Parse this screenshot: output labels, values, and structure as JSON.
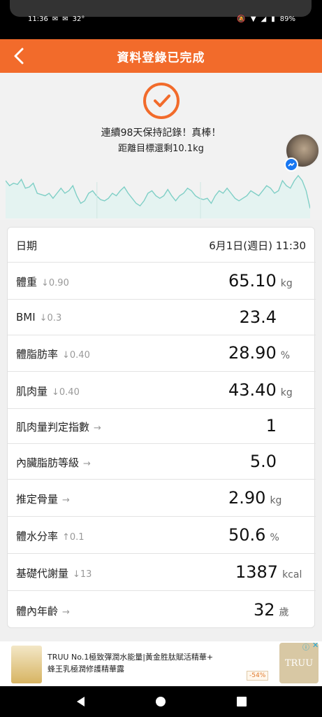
{
  "status_bar": {
    "time": "11:36",
    "temp": "32°",
    "battery": "89%"
  },
  "header": {
    "title": "資料登錄已完成"
  },
  "summary": {
    "streak_text": "連續98天保持記錄！真棒！",
    "remaining_text": "距離目標還剩10.1kg"
  },
  "colors": {
    "accent": "#f26b2b",
    "chart_line": "#7fcfc6"
  },
  "chart_data": {
    "type": "area",
    "values": [
      70,
      66,
      68,
      67,
      71,
      64,
      65,
      68,
      60,
      59,
      58,
      60,
      56,
      60,
      64,
      60,
      62,
      66,
      58,
      52,
      54,
      60,
      62,
      58,
      55,
      54,
      56,
      60,
      58,
      62,
      65,
      60,
      56,
      52,
      50,
      54,
      60,
      62,
      58,
      56,
      58,
      63,
      58,
      54,
      58,
      60,
      64,
      62,
      58,
      56,
      55,
      56,
      52,
      58,
      62,
      60,
      64,
      60,
      56,
      54,
      56,
      58,
      62,
      60,
      58,
      62,
      66,
      64,
      60,
      62,
      70,
      66,
      64,
      70,
      74,
      70,
      62,
      48
    ],
    "title": "",
    "xlabel": "",
    "ylabel": ""
  },
  "records": {
    "date": {
      "label": "日期",
      "value": "6月1日(週日) 11:30"
    },
    "rows": [
      {
        "label": "體重",
        "delta": "↓0.90",
        "value": "65.10",
        "unit": "kg"
      },
      {
        "label": "BMI",
        "delta": "↓0.3",
        "value": "23.4",
        "unit": ""
      },
      {
        "label": "體脂肪率",
        "delta": "↓0.40",
        "value": "28.90",
        "unit": "%"
      },
      {
        "label": "肌肉量",
        "delta": "↓0.40",
        "value": "43.40",
        "unit": "kg"
      },
      {
        "label": "肌肉量判定指數",
        "delta": "→",
        "value": "1",
        "unit": ""
      },
      {
        "label": "內臟脂肪等級",
        "delta": "→",
        "value": "5.0",
        "unit": ""
      },
      {
        "label": "推定骨量",
        "delta": "→",
        "value": "2.90",
        "unit": "kg"
      },
      {
        "label": "體水分率",
        "delta": "↑0.1",
        "value": "50.6",
        "unit": "%"
      },
      {
        "label": "基礎代謝量",
        "delta": "↓13",
        "value": "1387",
        "unit": "kcal"
      },
      {
        "label": "體內年齡",
        "delta": "→",
        "value": "32",
        "unit": "歲"
      }
    ]
  },
  "ad": {
    "line1": "TRUU No.1極致彈潤水能量|黃金胜肽賦活精華+",
    "line2": "蜂王乳極潤修護精華露",
    "discount": "-54%",
    "logo": "TRUU"
  }
}
